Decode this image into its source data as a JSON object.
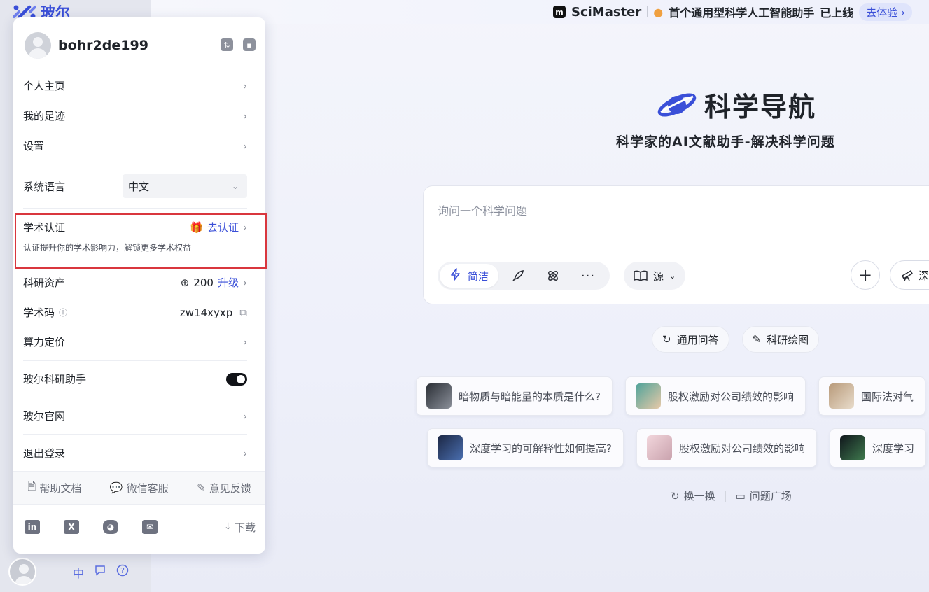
{
  "sidebar": {
    "logo_text": "玻尔",
    "bottom_icons": [
      "中",
      "💬",
      "?"
    ]
  },
  "banner": {
    "product": "SciMaster",
    "headline": "首个通用型科学人工智能助手",
    "status": "已上线",
    "cta": "去体验"
  },
  "hero": {
    "title": "科学导航",
    "subtitle": "科学家的AI文献助手-解决科学问题"
  },
  "ask": {
    "placeholder": "询问一个科学问题",
    "mode_label": "简洁",
    "source_label": "源",
    "deep_label": "深"
  },
  "quick_chips": [
    "通用问答",
    "科研绘图"
  ],
  "suggestions": {
    "row1": [
      "暗物质与暗能量的本质是什么?",
      "股权激励对公司绩效的影响",
      "国际法对气"
    ],
    "row2": [
      "深度学习的可解释性如何提高?",
      "股权激励对公司绩效的影响",
      "深度学习"
    ]
  },
  "suggestion_actions": {
    "refresh": "换一换",
    "square": "问题广场"
  },
  "popup": {
    "username": "bohr2de199",
    "items": {
      "profile": "个人主页",
      "history": "我的足迹",
      "settings": "设置",
      "language_label": "系统语言",
      "language_value": "中文",
      "cert_label": "学术认证",
      "cert_action": "去认证",
      "cert_desc": "认证提升你的学术影响力，解锁更多学术权益",
      "assets_label": "科研资产",
      "assets_value": "200",
      "upgrade": "升级",
      "code_label": "学术码",
      "code_value": "zw14xyxp",
      "pricing": "算力定价",
      "assistant": "玻尔科研助手",
      "website": "玻尔官网",
      "logout": "退出登录"
    },
    "assistant_enabled": true,
    "footer": {
      "docs": "帮助文档",
      "wechat": "微信客服",
      "feedback": "意见反馈"
    },
    "download": "下载"
  }
}
